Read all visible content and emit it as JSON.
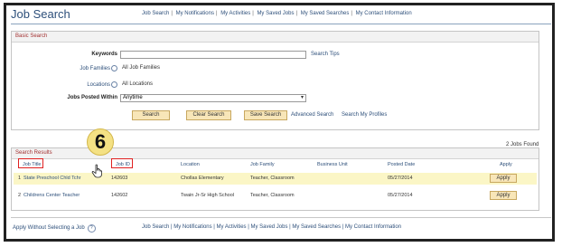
{
  "page": {
    "title": "Job Search"
  },
  "top_nav": [
    "Job Search",
    "My Notifications",
    "My Activities",
    "My Saved Jobs",
    "My Saved Searches",
    "My Contact Information"
  ],
  "basic_search": {
    "header": "Basic Search",
    "keywords_label": "Keywords",
    "keywords_value": "",
    "search_tips": "Search Tips",
    "job_families_label": "Job Families",
    "job_families_value": "All Job Families",
    "locations_label": "Locations",
    "locations_value": "All Locations",
    "posted_within_label": "Jobs Posted Within",
    "posted_within_value": "Anytime",
    "buttons": {
      "search": "Search",
      "clear": "Clear Search",
      "save": "Save Search"
    },
    "advanced_search": "Advanced Search",
    "search_profiles": "Search My Profiles"
  },
  "step_badge": "6",
  "results": {
    "header": "Search Results",
    "count": "2 Jobs Found",
    "columns": [
      "Job Title",
      "Job ID",
      "Location",
      "Job Family",
      "Business Unit",
      "Posted Date",
      "Apply"
    ],
    "rows": [
      {
        "num": "1",
        "title": "State Preschool Chld Tchr",
        "id": "142603",
        "location": "Chollas Elementary",
        "family": "Teacher, Classroom",
        "unit": "",
        "date": "05/27/2014",
        "apply": "Apply"
      },
      {
        "num": "2",
        "title": "Childrens Center Teacher",
        "id": "142602",
        "location": "Twain Jr-Sr High School",
        "family": "Teacher, Classroom",
        "unit": "",
        "date": "05/27/2014",
        "apply": "Apply"
      }
    ]
  },
  "footer": {
    "apply_without": "Apply Without Selecting a Job",
    "help_icon": "?"
  },
  "icons": {
    "lookup": "magnifier-icon",
    "cursor": "hand-pointer-icon",
    "help": "help-circle-icon"
  }
}
